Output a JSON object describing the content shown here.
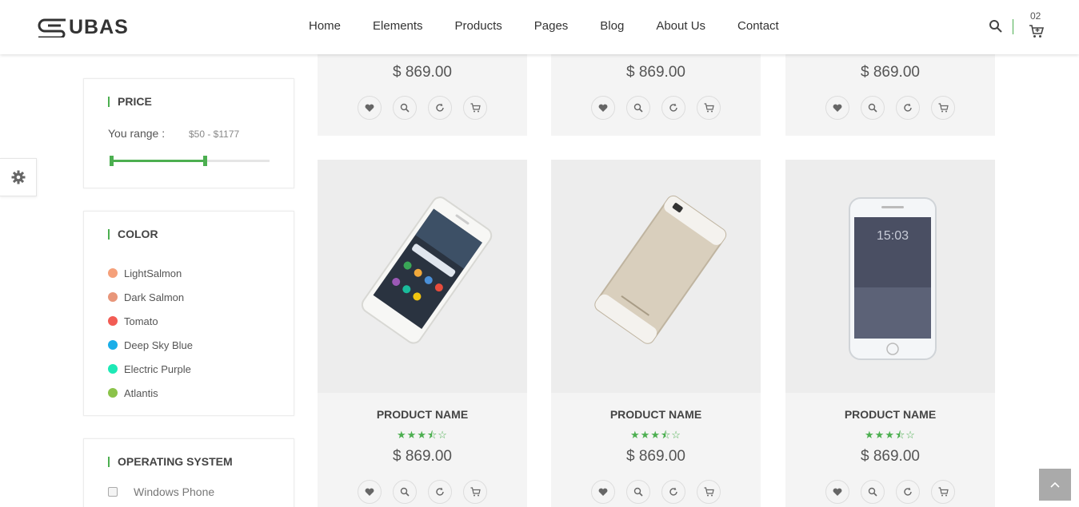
{
  "brand": {
    "logo_text": "UBAS"
  },
  "nav": {
    "items": [
      "Home",
      "Elements",
      "Products",
      "Pages",
      "Blog",
      "About Us",
      "Contact"
    ]
  },
  "header": {
    "cart_count": "02"
  },
  "sidebar": {
    "price": {
      "title": "PRICE",
      "range_label": "You range :",
      "range_value": "$50 - $1177"
    },
    "color": {
      "title": "COLOR",
      "items": [
        {
          "label": "LightSalmon",
          "color": "#f5a07a"
        },
        {
          "label": "Dark Salmon",
          "color": "#e8967a"
        },
        {
          "label": "Tomato",
          "color": "#f25c54"
        },
        {
          "label": "Deep Sky Blue",
          "color": "#1aaee8"
        },
        {
          "label": "Electric Purple",
          "color": "#1de9b6"
        },
        {
          "label": "Atlantis",
          "color": "#8bc34a"
        }
      ]
    },
    "os": {
      "title": "OPERATING SYSTEM",
      "items": [
        "Windows Phone"
      ]
    }
  },
  "products_top_row": [
    {
      "price": "$ 869.00"
    },
    {
      "price": "$ 869.00"
    },
    {
      "price": "$ 869.00"
    }
  ],
  "products": [
    {
      "name": "PRODUCT NAME",
      "rating": "★★★⯪☆",
      "price": "$ 869.00",
      "image": "phone-front-image"
    },
    {
      "name": "PRODUCT NAME",
      "rating": "★★★⯪☆",
      "price": "$ 869.00",
      "image": "phone-back-image"
    },
    {
      "name": "PRODUCT NAME",
      "rating": "★★★⯪☆",
      "price": "$ 869.00",
      "image": "iphone-image"
    }
  ],
  "colors": {
    "accent": "#4caf50",
    "card_bg": "#f4f4f4"
  }
}
